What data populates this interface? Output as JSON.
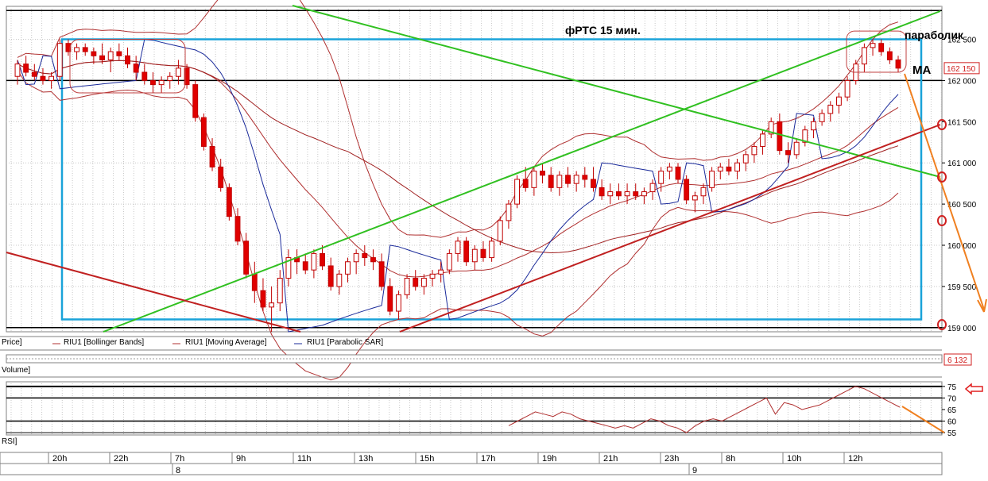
{
  "chart_data": [
    {
      "type": "candlestick",
      "title": "фРТС    15 мин.",
      "annotations": [
        "параболик",
        "MA"
      ],
      "y_ticks": [
        159000,
        159500,
        160000,
        160500,
        161000,
        161500,
        162000,
        162500
      ],
      "y_tick_labels": [
        "159 000",
        "159 500",
        "160 000",
        "160 500",
        "161 000",
        "161 500",
        "162 000",
        "162 500"
      ],
      "ylim": [
        158950,
        162900
      ],
      "last_price_label": "162 150",
      "legend": [
        "Price]",
        "RIU1 [Bollinger Bands]",
        "RIU1 [Moving Average]",
        "RIU1 [Parabolic SAR]"
      ],
      "candles_ohlc": [
        [
          162050,
          162250,
          161950,
          162200
        ],
        [
          162200,
          162300,
          162050,
          162100
        ],
        [
          162100,
          162200,
          162000,
          162050
        ],
        [
          162050,
          162150,
          161950,
          162000
        ],
        [
          162000,
          162100,
          161900,
          162050
        ],
        [
          162050,
          162500,
          162000,
          162450
        ],
        [
          162450,
          162500,
          162300,
          162350
        ],
        [
          162350,
          162450,
          162250,
          162400
        ],
        [
          162400,
          162450,
          162300,
          162350
        ],
        [
          162350,
          162400,
          162200,
          162300
        ],
        [
          162300,
          162450,
          162200,
          162250
        ],
        [
          162250,
          162400,
          162100,
          162350
        ],
        [
          162350,
          162450,
          162250,
          162300
        ],
        [
          162300,
          162400,
          162150,
          162200
        ],
        [
          162200,
          162300,
          162000,
          162100
        ],
        [
          162100,
          162200,
          161950,
          162000
        ],
        [
          162000,
          162100,
          161850,
          161950
        ],
        [
          161950,
          162050,
          161850,
          162000
        ],
        [
          162000,
          162100,
          161900,
          162050
        ],
        [
          162050,
          162250,
          161950,
          162150
        ],
        [
          162150,
          162200,
          161900,
          161950
        ],
        [
          161950,
          162000,
          161500,
          161550
        ],
        [
          161550,
          161600,
          161150,
          161200
        ],
        [
          161200,
          161300,
          160900,
          160950
        ],
        [
          160950,
          161050,
          160650,
          160700
        ],
        [
          160700,
          160750,
          160300,
          160350
        ],
        [
          160350,
          160450,
          160000,
          160050
        ],
        [
          160050,
          160150,
          159600,
          159650
        ],
        [
          159650,
          159800,
          159300,
          159450
        ],
        [
          159450,
          159600,
          159200,
          159250
        ],
        [
          159250,
          159500,
          158950,
          159300
        ],
        [
          159300,
          159700,
          159200,
          159600
        ],
        [
          159600,
          159950,
          159500,
          159850
        ],
        [
          159850,
          159950,
          159650,
          159800
        ],
        [
          159800,
          159900,
          159650,
          159700
        ],
        [
          159700,
          159950,
          159600,
          159900
        ],
        [
          159900,
          160000,
          159700,
          159750
        ],
        [
          159750,
          159850,
          159450,
          159500
        ],
        [
          159500,
          159700,
          159400,
          159650
        ],
        [
          159650,
          159850,
          159550,
          159800
        ],
        [
          159800,
          159950,
          159650,
          159900
        ],
        [
          159900,
          160000,
          159750,
          159850
        ],
        [
          159850,
          159950,
          159700,
          159800
        ],
        [
          159800,
          159900,
          159450,
          159500
        ],
        [
          159500,
          159600,
          159150,
          159200
        ],
        [
          159200,
          159450,
          159100,
          159400
        ],
        [
          159400,
          159650,
          159350,
          159600
        ],
        [
          159600,
          159700,
          159450,
          159500
        ],
        [
          159500,
          159650,
          159400,
          159600
        ],
        [
          159600,
          159700,
          159500,
          159650
        ],
        [
          159650,
          159800,
          159550,
          159700
        ],
        [
          159700,
          159950,
          159650,
          159900
        ],
        [
          159900,
          160100,
          159800,
          160050
        ],
        [
          160050,
          160100,
          159750,
          159800
        ],
        [
          159800,
          160000,
          159700,
          159950
        ],
        [
          159950,
          160050,
          159800,
          159850
        ],
        [
          159850,
          160100,
          159800,
          160050
        ],
        [
          160050,
          160350,
          160000,
          160300
        ],
        [
          160300,
          160550,
          160200,
          160500
        ],
        [
          160500,
          160850,
          160450,
          160800
        ],
        [
          160800,
          160950,
          160650,
          160700
        ],
        [
          160700,
          160950,
          160600,
          160900
        ],
        [
          160900,
          161000,
          160750,
          160850
        ],
        [
          160850,
          160950,
          160650,
          160700
        ],
        [
          160700,
          160900,
          160600,
          160850
        ],
        [
          160850,
          160950,
          160700,
          160750
        ],
        [
          160750,
          160900,
          160650,
          160850
        ],
        [
          160850,
          160950,
          160700,
          160800
        ],
        [
          160800,
          160950,
          160650,
          160700
        ],
        [
          160700,
          160800,
          160550,
          160600
        ],
        [
          160600,
          160750,
          160500,
          160650
        ],
        [
          160650,
          160750,
          160550,
          160600
        ],
        [
          160600,
          160750,
          160500,
          160650
        ],
        [
          160650,
          160750,
          160550,
          160600
        ],
        [
          160600,
          160700,
          160500,
          160650
        ],
        [
          160650,
          160800,
          160550,
          160750
        ],
        [
          160750,
          160950,
          160650,
          160900
        ],
        [
          160900,
          161000,
          160800,
          160950
        ],
        [
          160950,
          161000,
          160750,
          160800
        ],
        [
          160800,
          160850,
          160500,
          160550
        ],
        [
          160550,
          160650,
          160400,
          160600
        ],
        [
          160600,
          160750,
          160500,
          160700
        ],
        [
          160700,
          160950,
          160650,
          160900
        ],
        [
          160900,
          161000,
          160800,
          160950
        ],
        [
          160950,
          161050,
          160850,
          160900
        ],
        [
          160900,
          161050,
          160800,
          161000
        ],
        [
          161000,
          161150,
          160900,
          161100
        ],
        [
          161100,
          161250,
          161000,
          161200
        ],
        [
          161200,
          161400,
          161100,
          161350
        ],
        [
          161350,
          161550,
          161300,
          161500
        ],
        [
          161500,
          161600,
          161100,
          161150
        ],
        [
          161150,
          161250,
          161000,
          161100
        ],
        [
          161100,
          161300,
          161050,
          161250
        ],
        [
          161250,
          161450,
          161200,
          161400
        ],
        [
          161400,
          161550,
          161300,
          161500
        ],
        [
          161500,
          161650,
          161450,
          161600
        ],
        [
          161600,
          161750,
          161500,
          161700
        ],
        [
          161700,
          161850,
          161600,
          161800
        ],
        [
          161800,
          162050,
          161750,
          162000
        ],
        [
          162000,
          162250,
          161950,
          162200
        ],
        [
          162200,
          162450,
          162100,
          162400
        ],
        [
          162400,
          162500,
          162300,
          162450
        ],
        [
          162450,
          162500,
          162300,
          162350
        ],
        [
          162350,
          162400,
          162200,
          162250
        ],
        [
          162250,
          162300,
          162100,
          162150
        ]
      ]
    },
    {
      "type": "line",
      "title": "Volume]",
      "last_value_label": "6 132"
    },
    {
      "type": "line",
      "title": "RSI]",
      "y_ticks": [
        55,
        60,
        65,
        70,
        75
      ],
      "y_tick_labels": [
        "55",
        "60",
        "65",
        "70",
        "75"
      ],
      "ylim": [
        54,
        77
      ],
      "values": [
        58,
        60,
        62,
        64,
        63,
        62,
        64,
        63,
        61,
        60,
        59,
        58,
        57,
        58,
        57,
        59,
        61,
        60,
        58,
        57,
        55,
        58,
        60,
        61,
        60,
        62,
        64,
        66,
        68,
        70,
        63,
        68,
        67,
        65,
        66,
        67,
        69,
        71,
        73,
        75,
        74,
        72,
        70,
        68,
        66
      ]
    }
  ],
  "x_axis": {
    "time_labels": [
      "20h",
      "22h",
      "7h",
      "9h",
      "11h",
      "13h",
      "15h",
      "17h",
      "19h",
      "21h",
      "23h",
      "8h",
      "10h",
      "12h"
    ],
    "date_labels": [
      "8",
      "9"
    ]
  }
}
